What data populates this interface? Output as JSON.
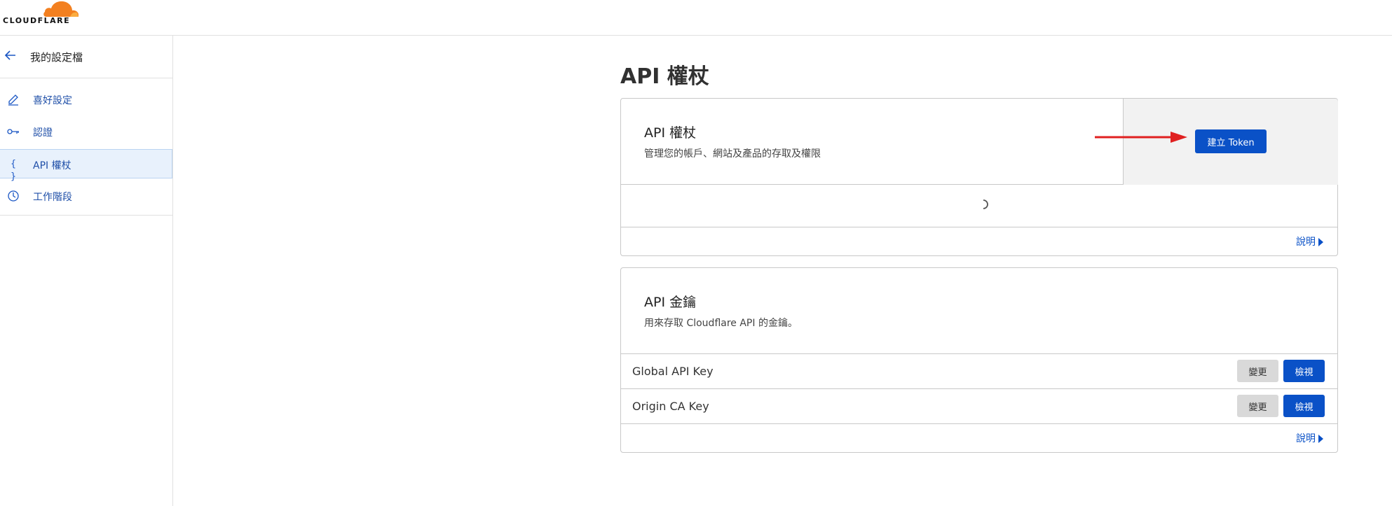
{
  "brand": {
    "name": "CLOUDFLARE",
    "accent": "#f38020"
  },
  "sidebar": {
    "back_label": "我的設定檔",
    "items": [
      {
        "label": "喜好設定",
        "icon": "pencil-icon",
        "active": false
      },
      {
        "label": "認證",
        "icon": "key-icon",
        "active": false
      },
      {
        "label": "API 權杖",
        "icon": "braces-icon",
        "active": true
      },
      {
        "label": "工作階段",
        "icon": "clock-icon",
        "active": false
      }
    ]
  },
  "main": {
    "page_title": "API 權杖",
    "tokens_card": {
      "title": "API 權杖",
      "description": "管理您的帳戶、網站及產品的存取及權限",
      "create_button": "建立 Token",
      "help_link": "說明"
    },
    "keys_card": {
      "title": "API 金鑰",
      "description": "用來存取 Cloudflare API 的金鑰。",
      "rows": [
        {
          "name": "Global API Key",
          "change_label": "變更",
          "view_label": "檢視"
        },
        {
          "name": "Origin CA Key",
          "change_label": "變更",
          "view_label": "檢視"
        }
      ],
      "help_link": "說明"
    }
  },
  "colors": {
    "primary_button": "#0a51c7",
    "active_nav_bg": "#e8f1fc",
    "annotation_arrow": "#e02020"
  }
}
